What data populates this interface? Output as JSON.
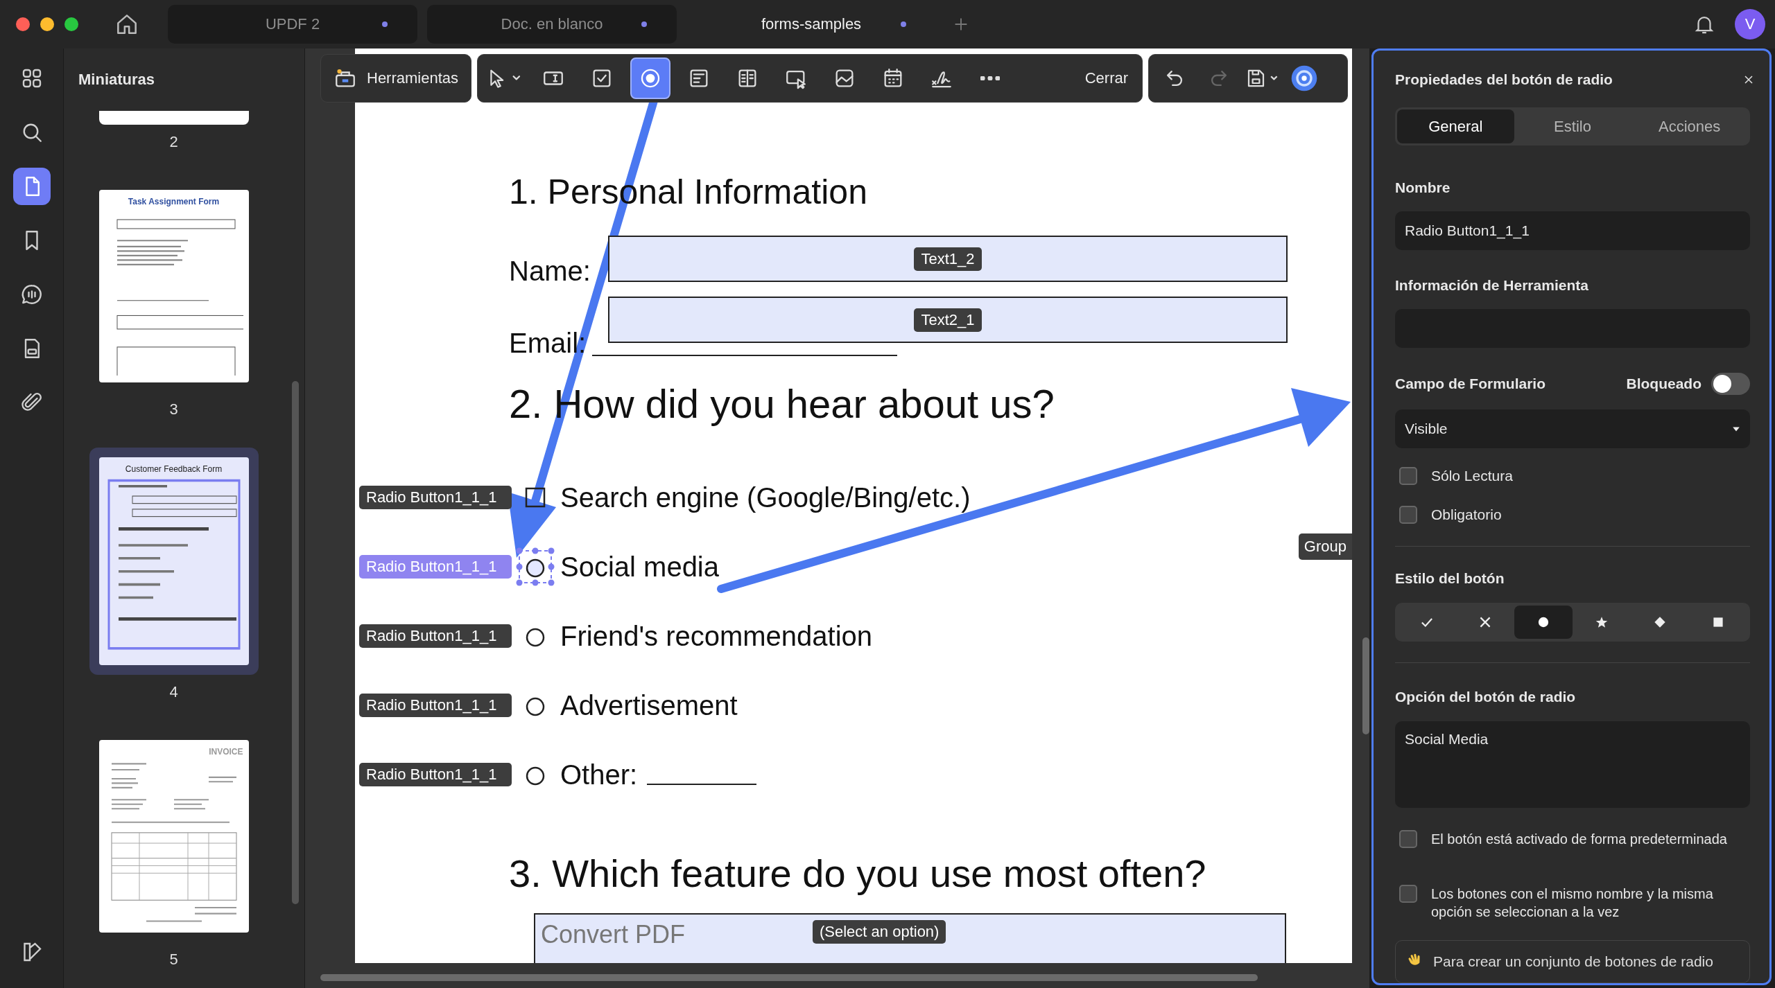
{
  "window_tabs": [
    {
      "label": "UPDF 2",
      "selected": false
    },
    {
      "label": "Doc. en blanco",
      "selected": false
    },
    {
      "label": "forms-samples",
      "selected": true
    }
  ],
  "avatar": "V",
  "rail": [
    {
      "kind": "grid",
      "selected": false
    },
    {
      "kind": "search",
      "selected": false
    },
    {
      "kind": "pages",
      "selected": true
    },
    {
      "kind": "bookmark",
      "selected": false
    },
    {
      "kind": "comment",
      "selected": false
    },
    {
      "kind": "form",
      "selected": false
    },
    {
      "kind": "attachment",
      "selected": false
    }
  ],
  "thumbnails": {
    "title": "Miniaturas",
    "pages": [
      {
        "kind": "edge",
        "label": "2",
        "selected": false
      },
      {
        "kind": "form",
        "label": "3",
        "title": "Task Assignment Form",
        "selected": false
      },
      {
        "kind": "feedback",
        "label": "4",
        "title": "Customer Feedback Form",
        "selected": true
      },
      {
        "kind": "invoice",
        "label": "5",
        "title": "INVOICE",
        "selected": false
      }
    ]
  },
  "toolbar": {
    "tools_label": "Herramientas",
    "tools": [
      {
        "kind": "pointer",
        "selected": false
      },
      {
        "kind": "textfield",
        "selected": false
      },
      {
        "kind": "checkbox",
        "selected": false
      },
      {
        "kind": "radio",
        "selected": true
      },
      {
        "kind": "combobox",
        "selected": false
      },
      {
        "kind": "listbox",
        "selected": false
      },
      {
        "kind": "button",
        "selected": false
      },
      {
        "kind": "image",
        "selected": false
      },
      {
        "kind": "date",
        "selected": false
      },
      {
        "kind": "signature",
        "selected": false
      },
      {
        "kind": "more",
        "selected": false
      }
    ],
    "close": "Cerrar",
    "history": [
      {
        "kind": "undo",
        "disabled": false
      },
      {
        "kind": "redo",
        "disabled": true
      }
    ]
  },
  "document": {
    "heading_1": "1. Personal Information",
    "fields": [
      {
        "label": "Name:",
        "badge": "Text1_2"
      },
      {
        "label": "Email:",
        "badge": "Text2_1"
      }
    ],
    "heading_2": "2. How did you hear about us?",
    "options": [
      {
        "kind": "checkbox",
        "label": "Search engine (Google/Bing/etc.)",
        "badge": "Radio Button1_1_1",
        "selected": false,
        "blank": false
      },
      {
        "kind": "radio",
        "label": "Social media",
        "badge": "Radio Button1_1_1",
        "selected": true,
        "blank": false
      },
      {
        "kind": "radio",
        "label": "Friend's recommendation",
        "badge": "Radio Button1_1_1",
        "selected": false,
        "blank": false
      },
      {
        "kind": "radio",
        "label": "Advertisement",
        "badge": "Radio Button1_1_1",
        "selected": false,
        "blank": false
      },
      {
        "kind": "radio",
        "label": "Other:",
        "badge": "Radio Button1_1_1",
        "selected": false,
        "blank": true
      }
    ],
    "group_badge": "Group",
    "heading_3": "3. Which feature do you use most often?",
    "select": {
      "value": "Convert PDF",
      "badge": "(Select an option)"
    }
  },
  "panel": {
    "title": "Propiedades del botón de radio",
    "tabs": [
      {
        "label": "General",
        "selected": true
      },
      {
        "label": "Estilo",
        "selected": false
      },
      {
        "label": "Acciones",
        "selected": false
      }
    ],
    "name_label": "Nombre",
    "name_value": "Radio Button1_1_1",
    "tooltip_label": "Información de Herramienta",
    "form_field_label": "Campo de Formulario",
    "locked_label": "Bloqueado",
    "locked": false,
    "visibility": "Visible",
    "flags": [
      {
        "label": "Sólo Lectura",
        "checked": false
      },
      {
        "label": "Obligatorio",
        "checked": false
      }
    ],
    "style_label": "Estilo del botón",
    "styles": [
      {
        "kind": "check",
        "selected": false
      },
      {
        "kind": "cross",
        "selected": false
      },
      {
        "kind": "circle",
        "selected": true
      },
      {
        "kind": "star",
        "selected": false
      },
      {
        "kind": "diamond",
        "selected": false
      },
      {
        "kind": "square",
        "selected": false
      }
    ],
    "option_label": "Opción del botón de radio",
    "option_value": "Social Media",
    "defaults": [
      {
        "label": "El botón está activado de forma predeterminada",
        "checked": false
      },
      {
        "label": "Los botones con el mismo nombre y la misma opción se seleccionan a la vez",
        "checked": false
      }
    ],
    "tip": "Para crear un conjunto de botones de radio"
  }
}
